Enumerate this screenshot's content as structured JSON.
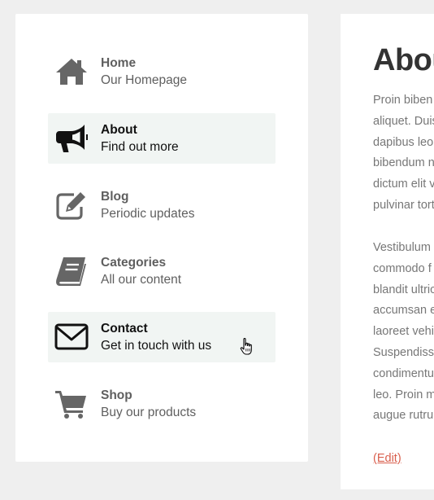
{
  "nav": {
    "items": [
      {
        "title": "Home",
        "subtitle": "Our Homepage",
        "icon": "home-icon"
      },
      {
        "title": "About",
        "subtitle": "Find out more",
        "icon": "megaphone-icon"
      },
      {
        "title": "Blog",
        "subtitle": "Periodic updates",
        "icon": "edit-icon"
      },
      {
        "title": "Categories",
        "subtitle": "All our content",
        "icon": "book-icon"
      },
      {
        "title": "Contact",
        "subtitle": "Get in touch with us",
        "icon": "envelope-icon"
      },
      {
        "title": "Shop",
        "subtitle": "Buy our products",
        "icon": "cart-icon"
      }
    ]
  },
  "main": {
    "title": "Abou",
    "paragraph1": [
      "Proin biben",
      "aliquet. Duis",
      "dapibus leo",
      "bibendum n",
      "dictum elit v",
      "pulvinar tort"
    ],
    "paragraph2": [
      "Vestibulum",
      "commodo f",
      "blandit ultric",
      "accumsan e",
      "laoreet vehi",
      "Suspendiss",
      "condimentu",
      "leo. Proin m",
      "augue rutru"
    ],
    "edit_label": "(Edit)"
  },
  "colors": {
    "highlight_bg": "#f1f5f3",
    "link": "#d95f4d",
    "muted_text": "#5f5f5f"
  }
}
